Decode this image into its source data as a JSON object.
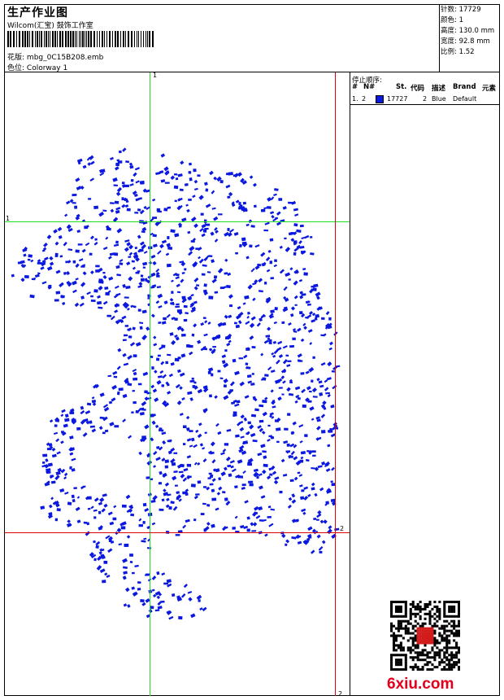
{
  "header": {
    "title": "生产作业图",
    "company": "Wilcom(汇宝) 鼓饰工作室",
    "design_label": "花版:",
    "design_value": "mbg_0C15B208.emb",
    "colorway_label": "色位:",
    "colorway_value": "Colorway 1"
  },
  "stats": [
    {
      "label": "针数:",
      "value": "17729"
    },
    {
      "label": "颜色:",
      "value": "1"
    },
    {
      "label": "高度:",
      "value": "130.0 mm"
    },
    {
      "label": "宽度:",
      "value": "92.8 mm"
    },
    {
      "label": "比例:",
      "value": "1.52"
    }
  ],
  "stop_sequence": {
    "title": "停止顺序:",
    "columns": [
      "#",
      "N#",
      "St.",
      "代码",
      "描述",
      "Brand",
      "元素"
    ],
    "rows": [
      {
        "index": "1.",
        "needle": "2",
        "swatch_color": "#0a18e0",
        "stitches": "17727",
        "code": "2",
        "description": "Blue",
        "brand": "Default",
        "element": ""
      }
    ]
  },
  "guides": {
    "green_label": "1",
    "red_label": "2"
  },
  "design_color": "#0a18e0",
  "watermark": "6xiu.com"
}
